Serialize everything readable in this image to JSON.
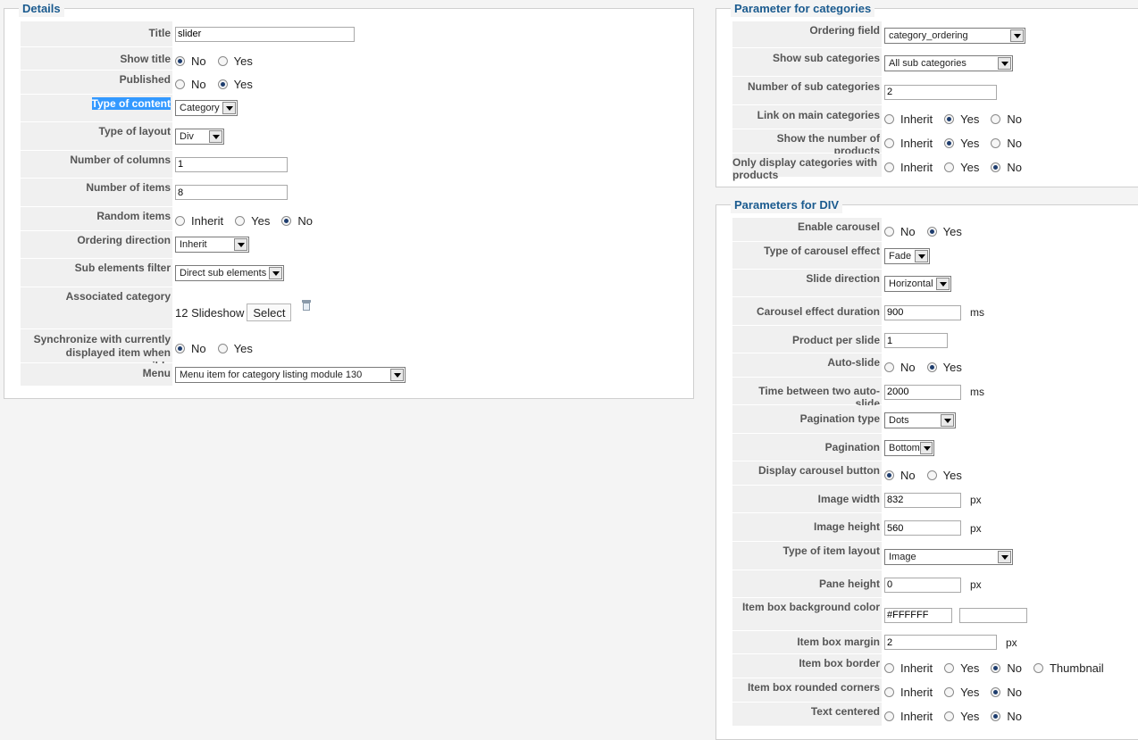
{
  "details": {
    "legend": "Details",
    "title_label": "Title",
    "title_value": "slider",
    "show_title_label": "Show title",
    "published_label": "Published",
    "type_content_label": "Type of content",
    "type_content_value": "Category",
    "type_layout_label": "Type of layout",
    "type_layout_value": "Div",
    "num_columns_label": "Number of columns",
    "num_columns_value": "1",
    "num_items_label": "Number of items",
    "num_items_value": "8",
    "random_items_label": "Random items",
    "ordering_direction_label": "Ordering direction",
    "ordering_direction_value": "Inherit",
    "sub_filter_label": "Sub elements filter",
    "sub_filter_value": "Direct sub elements",
    "assoc_category_label": "Associated category",
    "assoc_category_value": "12 Slideshow",
    "select_button": "Select",
    "sync_label_1": "Synchronize with currently",
    "sync_label_2": "displayed item when possible",
    "menu_label": "Menu",
    "menu_value": "Menu item for category listing module 130"
  },
  "opts": {
    "no": "No",
    "yes": "Yes",
    "inherit": "Inherit",
    "thumbnail": "Thumbnail"
  },
  "categories": {
    "legend": "Parameter for categories",
    "ordering_field_label": "Ordering field",
    "ordering_field_value": "category_ordering",
    "show_sub_label": "Show sub categories",
    "show_sub_value": "All sub categories",
    "num_sub_label": "Number of sub categories",
    "num_sub_value": "2",
    "link_main_label": "Link on main categories",
    "show_num_products_label": "Show the number of products",
    "only_display_label": "Only display categories with products"
  },
  "div": {
    "legend": "Parameters for DIV",
    "enable_carousel_label": "Enable carousel",
    "carousel_effect_label": "Type of carousel effect",
    "carousel_effect_value": "Fade",
    "slide_direction_label": "Slide direction",
    "slide_direction_value": "Horizontal",
    "effect_duration_label": "Carousel effect duration",
    "effect_duration_value": "900",
    "product_per_slide_label": "Product per slide",
    "product_per_slide_value": "1",
    "auto_slide_label": "Auto-slide",
    "time_between_label": "Time between two auto-slide",
    "time_between_value": "2000",
    "pagination_type_label": "Pagination type",
    "pagination_type_value": "Dots",
    "pagination_label": "Pagination",
    "pagination_value": "Bottom",
    "display_button_label": "Display carousel button",
    "image_width_label": "Image width",
    "image_width_value": "832",
    "image_height_label": "Image height",
    "image_height_value": "560",
    "item_layout_label": "Type of item layout",
    "item_layout_value": "Image",
    "pane_height_label": "Pane height",
    "pane_height_value": "0",
    "bg_color_label": "Item box background color",
    "bg_color_value": "#FFFFFF",
    "box_margin_label": "Item box margin",
    "box_margin_value": "2",
    "box_border_label": "Item box border",
    "rounded_label": "Item box rounded corners",
    "text_centered_label": "Text centered",
    "unit_ms": "ms",
    "unit_px": "px"
  }
}
